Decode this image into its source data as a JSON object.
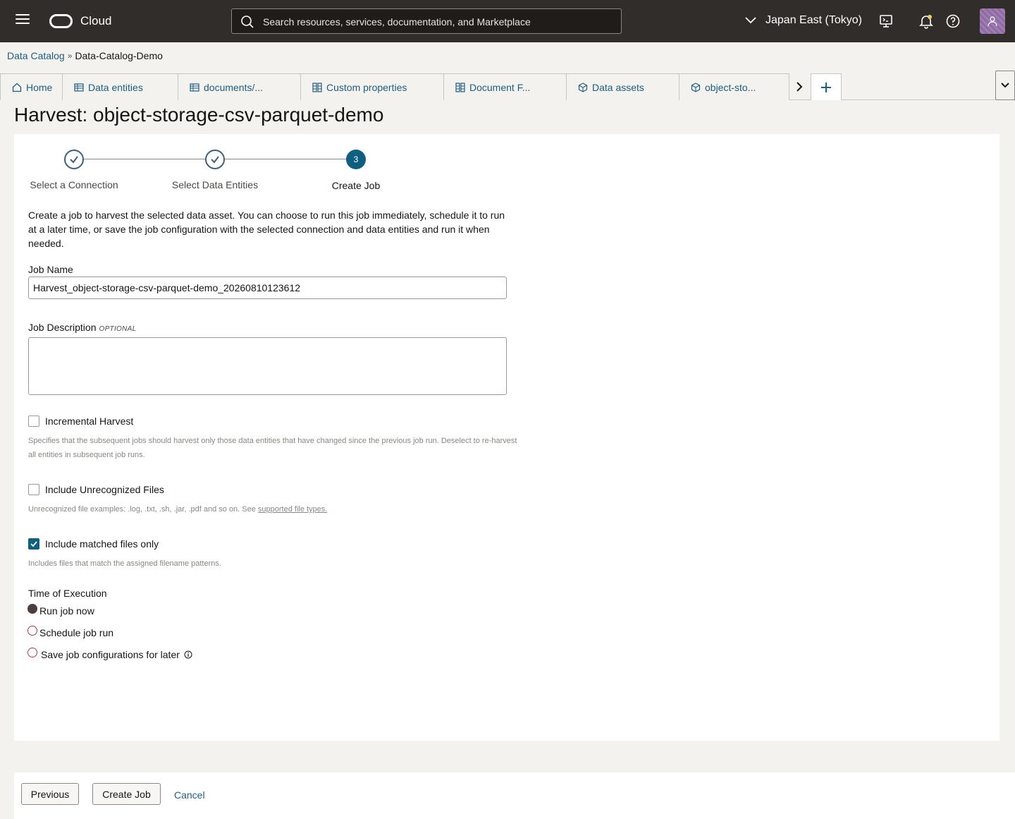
{
  "topbar": {
    "brand": "Cloud",
    "search_placeholder": "Search resources, services, documentation, and Marketplace",
    "region": "Japan East (Tokyo)"
  },
  "breadcrumb": {
    "root": "Data Catalog",
    "separator": "»",
    "current": "Data-Catalog-Demo"
  },
  "tabs": [
    {
      "label": "Home",
      "icon": "home-icon"
    },
    {
      "label": "Data entities",
      "icon": "table-icon"
    },
    {
      "label": "documents/...",
      "icon": "table-icon"
    },
    {
      "label": "Custom properties",
      "icon": "grid-icon"
    },
    {
      "label": "Document F...",
      "icon": "grid-icon"
    },
    {
      "label": "Data assets",
      "icon": "cube-icon"
    },
    {
      "label": "object-sto...",
      "icon": "cube-icon"
    }
  ],
  "page_title": "Harvest: object-storage-csv-parquet-demo",
  "stepper": {
    "steps": [
      {
        "label": "Select a Connection",
        "state": "done"
      },
      {
        "label": "Select Data Entities",
        "state": "done"
      },
      {
        "label": "Create Job",
        "state": "active",
        "number": "3"
      }
    ]
  },
  "intro": "Create a job to harvest the selected data asset. You can choose to run this job immediately, schedule it to run at a later time, or save the job configuration with the selected connection and data entities and run it when needed.",
  "form": {
    "job_name_label": "Job Name",
    "job_name_value": "Harvest_object-storage-csv-parquet-demo_20260810123612",
    "job_description_label": "Job Description",
    "optional_tag": "OPTIONAL",
    "job_description_value": "",
    "incremental": {
      "label": "Incremental Harvest",
      "checked": false,
      "help": "Specifies that the subsequent jobs should harvest only those data entities that have changed since the previous job run. Deselect to re-harvest all entities in subsequent job runs."
    },
    "unrecognized": {
      "label": "Include Unrecognized Files",
      "checked": false,
      "help": "Unrecognized file examples: .log, .txt, .sh, .jar, .pdf and so on. See ",
      "help_link": "supported file types."
    },
    "matched": {
      "label": "Include matched files only",
      "checked": true,
      "help": "Includes files that match the assigned filename patterns."
    },
    "time_of_execution_label": "Time of Execution",
    "execution_options": [
      {
        "label": "Run job now",
        "selected": true
      },
      {
        "label": "Schedule job run",
        "selected": false
      },
      {
        "label": "Save job configurations for later",
        "selected": false
      }
    ]
  },
  "footer": {
    "previous_label": "Previous",
    "create_label": "Create Job",
    "cancel_label": "Cancel"
  },
  "colors": {
    "topbar": "#312d2a",
    "accent": "#0f5f81",
    "link": "#1f5d83"
  }
}
